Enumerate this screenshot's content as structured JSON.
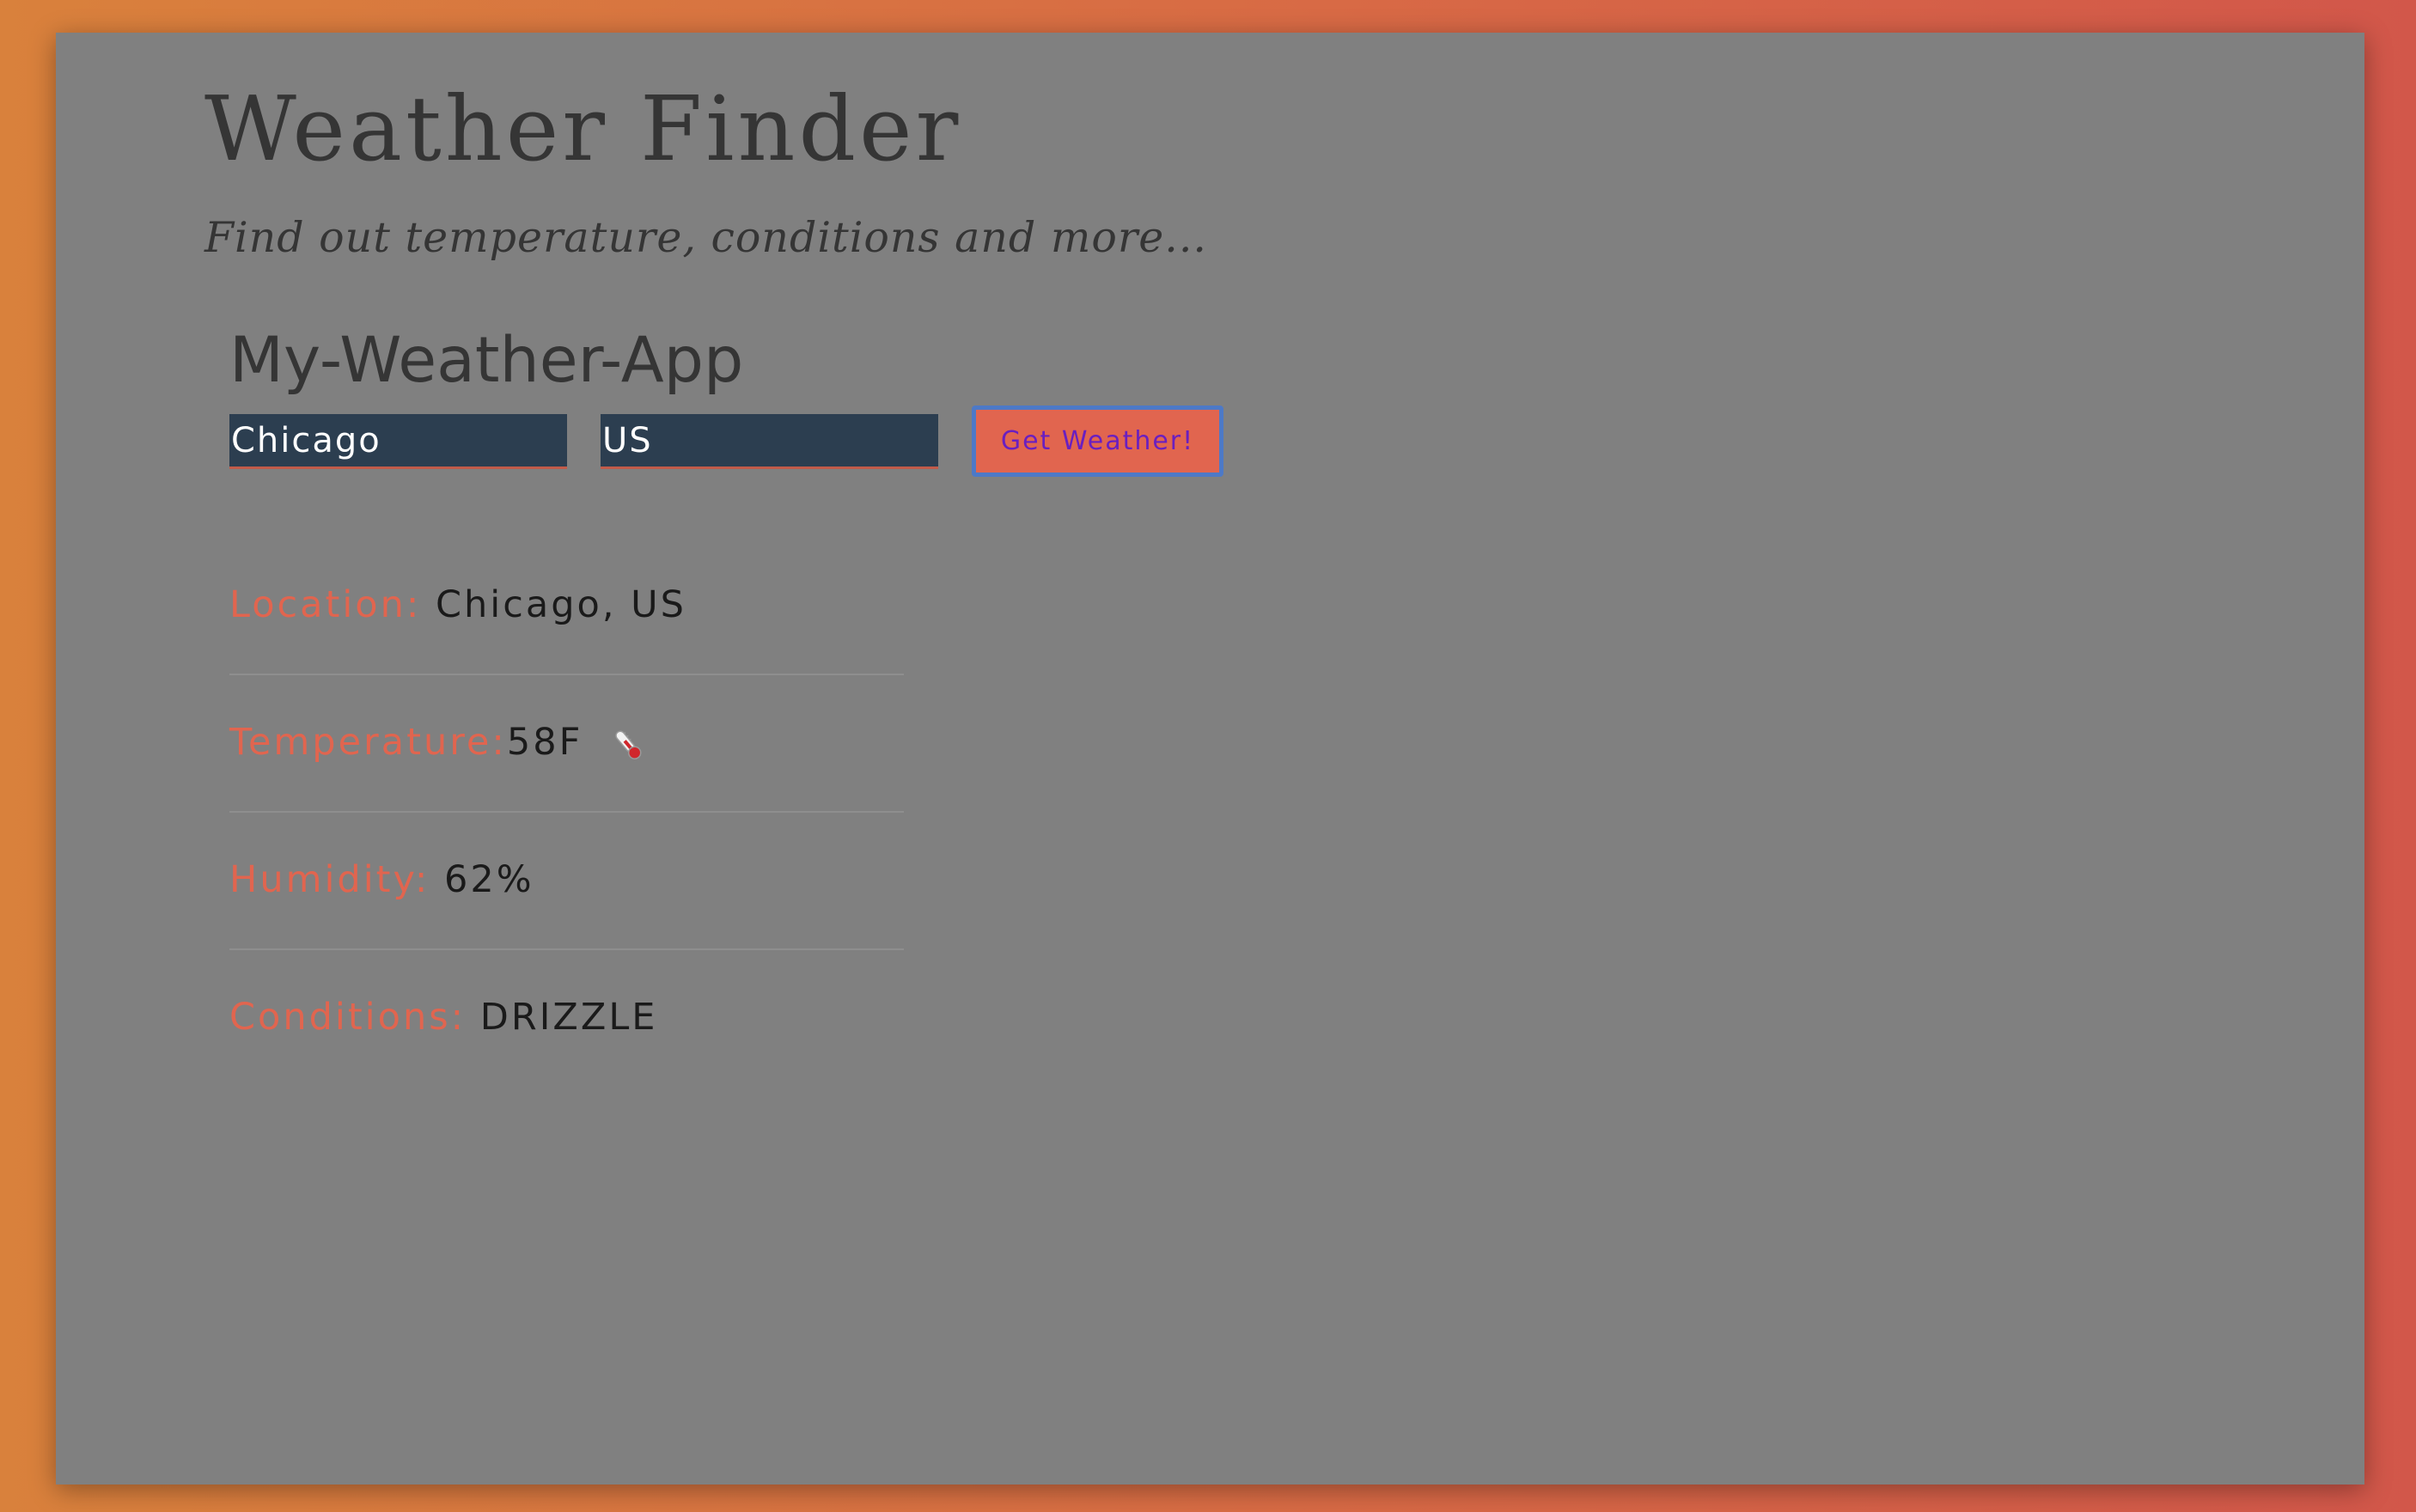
{
  "header": {
    "title": "Weather Finder",
    "subtitle": "Find out temperature, conditions and more..."
  },
  "app": {
    "title": "My-Weather-App"
  },
  "form": {
    "city_value": "Chicago",
    "country_value": "US",
    "button_label": "Get Weather!"
  },
  "results": {
    "location_label": "Location:",
    "location_value": "Chicago, US",
    "temperature_label": "Temperature:",
    "temperature_value": "58F",
    "temperature_icon": "thermometer-icon",
    "humidity_label": "Humidity:",
    "humidity_value": "62%",
    "conditions_label": "Conditions:",
    "conditions_value": "DRIZZLE"
  },
  "colors": {
    "panel_background": "#808080",
    "label_accent": "#e1654f",
    "input_background": "#2c3e50",
    "button_background": "#e1654f",
    "button_border": "#4d79c7",
    "button_text": "#6a1fc0"
  }
}
